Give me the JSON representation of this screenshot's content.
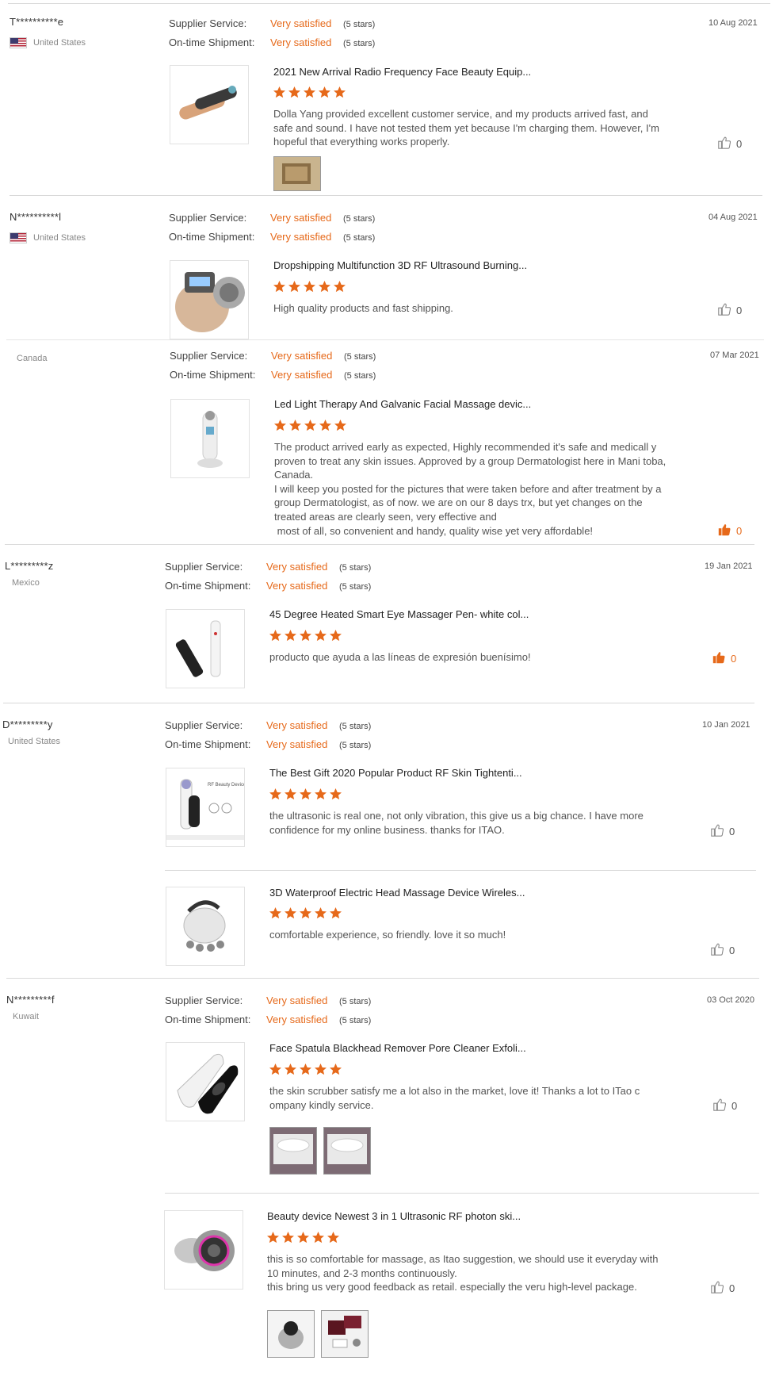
{
  "colors": {
    "accent": "#e6691a",
    "divider": "#d9d9d9"
  },
  "reviews": [
    {
      "buyer": "T**********e",
      "country": "United States",
      "flag": "us-flag-icon",
      "supplier_label": "Supplier Service:",
      "supplier_value": "Very satisfied",
      "supplier_stars": "(5 stars)",
      "shipment_label": "On-time Shipment:",
      "shipment_value": "Very satisfied",
      "shipment_stars": "(5 stars)",
      "date": "10 Aug 2021",
      "items": [
        {
          "title": "2021 New Arrival Radio Frequency Face Beauty Equip...",
          "rating": 5,
          "comment": "Dolla Yang provided excellent customer service, and my products arrived fast, and safe and sound. I have not tested them yet because I'm charging them. However, I'm hopeful that everything works properly.",
          "likes": "0",
          "liked": false,
          "photos": 1
        }
      ]
    },
    {
      "buyer": "N**********l",
      "country": "United States",
      "flag": "us-flag-icon",
      "supplier_label": "Supplier Service:",
      "supplier_value": "Very satisfied",
      "supplier_stars": "(5 stars)",
      "shipment_label": "On-time Shipment:",
      "shipment_value": "Very satisfied",
      "shipment_stars": "(5 stars)",
      "date": "04 Aug 2021",
      "items": [
        {
          "title": "Dropshipping Multifunction 3D RF Ultrasound Burning...",
          "rating": 5,
          "comment": "High quality products and fast shipping.",
          "likes": "0",
          "liked": false,
          "photos": 0
        }
      ]
    },
    {
      "buyer": "",
      "country": "Canada",
      "flag": "",
      "supplier_label": "Supplier Service:",
      "supplier_value": "Very satisfied",
      "supplier_stars": "(5 stars)",
      "shipment_label": "On-time Shipment:",
      "shipment_value": "Very satisfied",
      "shipment_stars": "(5 stars)",
      "date": "07 Mar 2021",
      "items": [
        {
          "title": "Led Light Therapy And Galvanic Facial Massage devic...",
          "rating": 5,
          "comment": "The product arrived early as expected, Highly recommended it's safe and medicall y proven to treat any skin issues. Approved by a group Dermatologist here in Mani toba, Canada.\nI will keep you posted for the pictures that were taken before and after treatment by a group Dermatologist, as of now. we are on our 8 days trx, but yet changes on the treated areas are clearly seen, very effective and\n most of all, so convenient and handy, quality wise yet very affordable!",
          "likes": "0",
          "liked": true,
          "photos": 0
        }
      ]
    },
    {
      "buyer": "L*********z",
      "country": "Mexico",
      "flag": "",
      "supplier_label": "Supplier Service:",
      "supplier_value": "Very satisfied",
      "supplier_stars": "(5 stars)",
      "shipment_label": "On-time Shipment:",
      "shipment_value": "Very satisfied",
      "shipment_stars": "(5 stars)",
      "date": "19 Jan 2021",
      "items": [
        {
          "title": "45 Degree Heated Smart Eye Massager Pen- white col...",
          "rating": 5,
          "comment": "producto que ayuda a las líneas de expresión buenísimo!",
          "likes": "0",
          "liked": true,
          "photos": 0
        }
      ]
    },
    {
      "buyer": "D*********y",
      "country": "United States",
      "flag": "",
      "supplier_label": "Supplier Service:",
      "supplier_value": "Very satisfied",
      "supplier_stars": "(5 stars)",
      "shipment_label": "On-time Shipment:",
      "shipment_value": "Very satisfied",
      "shipment_stars": "(5 stars)",
      "date": "10 Jan 2021",
      "items": [
        {
          "title": "The Best Gift 2020 Popular Product RF Skin Tightenti...",
          "rating": 5,
          "comment": "the ultrasonic is real one, not only vibration, this give us a big chance. I have more confidence for my online business. thanks for ITAO.",
          "likes": "0",
          "liked": false,
          "photos": 0
        },
        {
          "title": "3D Waterproof Electric Head Massage Device Wireles...",
          "rating": 5,
          "comment": "comfortable experience, so friendly. love it so much!",
          "likes": "0",
          "liked": false,
          "photos": 0
        }
      ]
    },
    {
      "buyer": "N*********f",
      "country": "Kuwait",
      "flag": "",
      "supplier_label": "Supplier Service:",
      "supplier_value": "Very satisfied",
      "supplier_stars": "(5 stars)",
      "shipment_label": "On-time Shipment:",
      "shipment_value": "Very satisfied",
      "shipment_stars": "(5 stars)",
      "date": "03 Oct 2020",
      "items": [
        {
          "title": "Face Spatula Blackhead Remover Pore Cleaner Exfoli...",
          "rating": 5,
          "comment": "the skin scrubber satisfy me a lot also in the market, love it! Thanks a lot to ITao c ompany kindly service.",
          "likes": "0",
          "liked": false,
          "photos": 2
        },
        {
          "title": "Beauty device Newest 3 in 1 Ultrasonic RF photon ski...",
          "rating": 5,
          "comment": "this is so comfortable for massage, as Itao suggestion, we should use it everyday with 10 minutes, and 2-3 months continuously.\nthis bring us very good feedback as retail. especially the veru high-level package.",
          "likes": "0",
          "liked": false,
          "photos": 2
        }
      ]
    }
  ]
}
